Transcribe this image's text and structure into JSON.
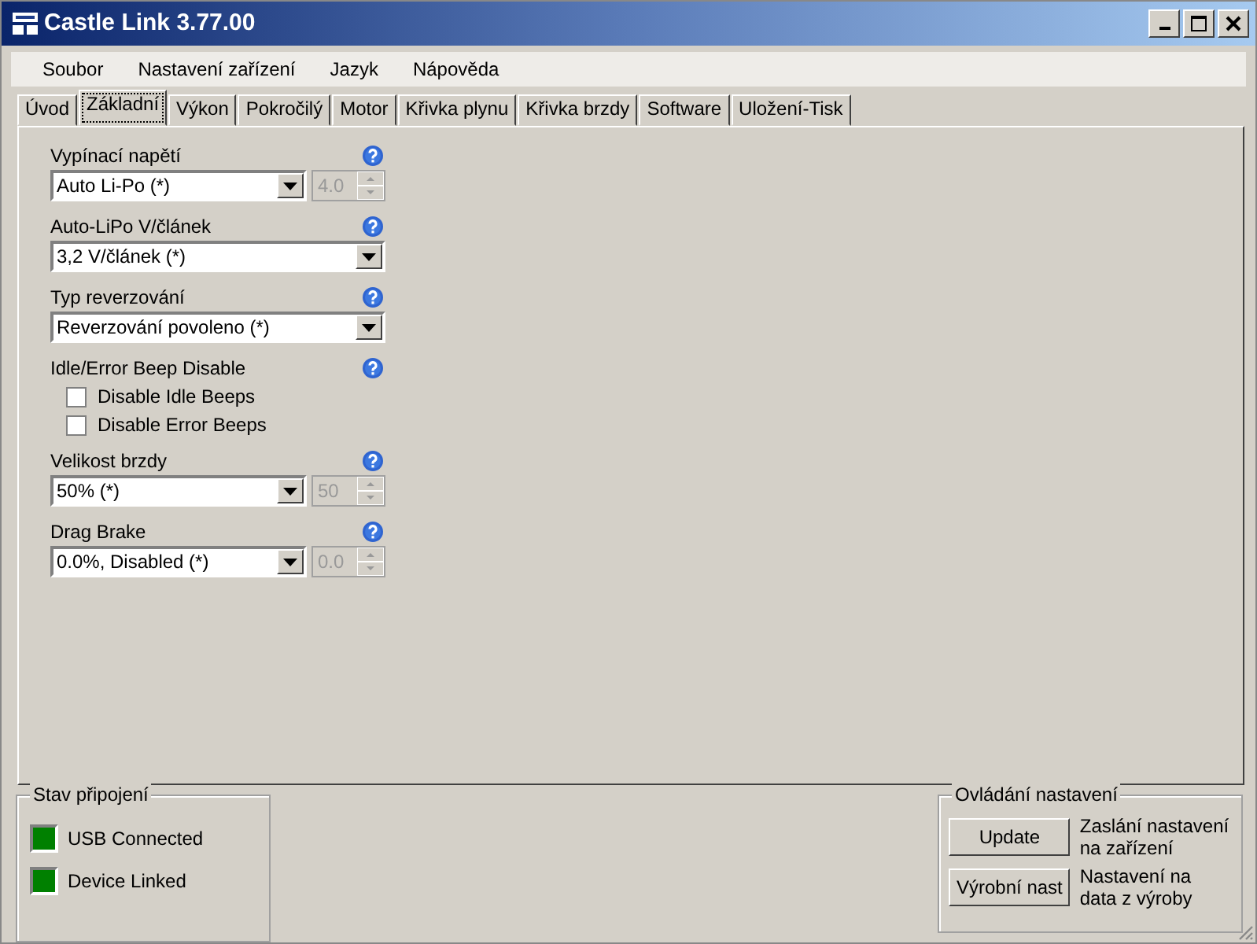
{
  "window": {
    "title": "Castle Link 3.77.00"
  },
  "menu": [
    "Soubor",
    "Nastavení zařízení",
    "Jazyk",
    "Nápověda"
  ],
  "tabs": [
    {
      "label": "Úvod",
      "selected": false
    },
    {
      "label": "Základní",
      "selected": true
    },
    {
      "label": "Výkon",
      "selected": false
    },
    {
      "label": "Pokročilý",
      "selected": false
    },
    {
      "label": "Motor",
      "selected": false
    },
    {
      "label": "Křivka plynu",
      "selected": false
    },
    {
      "label": "Křivka brzdy",
      "selected": false
    },
    {
      "label": "Software",
      "selected": false
    },
    {
      "label": "Uložení-Tisk",
      "selected": false
    }
  ],
  "settings": [
    {
      "kind": "select",
      "label": "Vypínací napětí",
      "value": "Auto Li-Po (*)",
      "spinner": "4.0"
    },
    {
      "kind": "select",
      "label": "Auto-LiPo V/článek",
      "value": "3,2 V/článek (*)"
    },
    {
      "kind": "select",
      "label": "Typ reverzování",
      "value": "Reverzování povoleno (*)"
    },
    {
      "kind": "checks",
      "label": "Idle/Error Beep Disable",
      "options": [
        {
          "label": "Disable Idle Beeps",
          "checked": false
        },
        {
          "label": "Disable Error Beeps",
          "checked": false
        }
      ]
    },
    {
      "kind": "select",
      "label": "Velikost brzdy",
      "value": "50% (*)",
      "spinner": "50"
    },
    {
      "kind": "select",
      "label": "Drag Brake",
      "value": "0.0%, Disabled (*)",
      "spinner": "0.0"
    }
  ],
  "connection": {
    "title": "Stav připojení",
    "items": [
      {
        "label": "USB Connected",
        "on": true
      },
      {
        "label": "Device Linked",
        "on": true
      }
    ]
  },
  "controls": {
    "title": "Ovládání nastavení",
    "items": [
      {
        "button": "Update",
        "description": "Zaslání nastavení na zařízení"
      },
      {
        "button": "Výrobní nast",
        "description": "Nastavení na data z výroby"
      }
    ]
  }
}
